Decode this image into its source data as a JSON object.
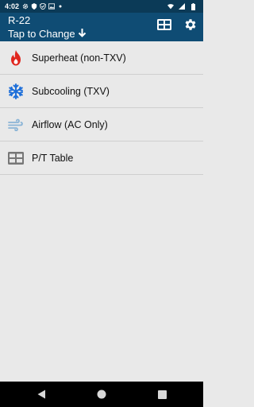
{
  "status_bar": {
    "time": "4:02",
    "icons": [
      "gear-icon",
      "shield-icon",
      "checkmark-shield-icon",
      "image-icon",
      "dot-icon"
    ],
    "right_icons": [
      "wifi-icon",
      "signal-icon",
      "battery-icon"
    ]
  },
  "header": {
    "refrigerant": "R-22",
    "tap_to_change": "Tap to Change",
    "table_icon": "table-icon",
    "settings_icon": "gear-icon",
    "background": "#0f4c74"
  },
  "menu": {
    "items": [
      {
        "label": "Superheat (non-TXV)",
        "icon": "flame-icon",
        "color": "#e0261e"
      },
      {
        "label": "Subcooling (TXV)",
        "icon": "snowflake-icon",
        "color": "#1e6fd9"
      },
      {
        "label": "Airflow (AC Only)",
        "icon": "wind-icon",
        "color": "#8ab4d6"
      },
      {
        "label": "P/T Table",
        "icon": "table-icon",
        "color": "#777777"
      }
    ]
  },
  "nav_bar": {
    "icons": [
      "back-icon",
      "home-icon",
      "recents-icon"
    ]
  }
}
